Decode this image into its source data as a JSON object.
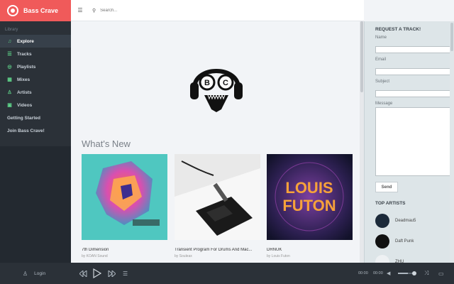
{
  "app": {
    "name": "Bass Crave"
  },
  "sidebar": {
    "section_label": "Library",
    "items": [
      {
        "label": "Explore",
        "icon": "music-note-icon",
        "active": true
      },
      {
        "label": "Tracks",
        "icon": "list-icon"
      },
      {
        "label": "Playlists",
        "icon": "playlist-circle-icon"
      },
      {
        "label": "Mixes",
        "icon": "grid-icon"
      },
      {
        "label": "Artists",
        "icon": "user-icon"
      },
      {
        "label": "Videos",
        "icon": "video-icon"
      }
    ],
    "getting_started": "Getting Started",
    "join": "Join Bass Crave!"
  },
  "topbar": {
    "search_placeholder": "Search..."
  },
  "main": {
    "section_title": "What's New",
    "cards": [
      {
        "title": "7th Dimension",
        "artist": "by KOAN Sound"
      },
      {
        "title": "Transient Program For Drums And Mac...",
        "artist": "by Souleax"
      },
      {
        "title": "DRNUK",
        "artist": "by Louis Futon"
      }
    ],
    "hero_letters": {
      "left": "B",
      "right": "C"
    }
  },
  "right_panel": {
    "request_title": "REQUEST A TRACK!",
    "fields": {
      "name": "Name",
      "email": "Email",
      "subject": "Subject",
      "message": "Message"
    },
    "send_label": "Send",
    "top_artists_title": "TOP ARTISTS",
    "artists": [
      {
        "name": "Deadmau5"
      },
      {
        "name": "Daft Punk"
      },
      {
        "name": "ZHU"
      }
    ]
  },
  "player": {
    "login_label": "Login",
    "current_time": "00:00",
    "duration": "00:00"
  },
  "colors": {
    "brand": "#f05a5a",
    "sidebar_bg": "#2b3138",
    "accent_icon": "#5fd38a",
    "main_bg": "#f2f4f7",
    "right_panel_bg": "#dde5e8"
  }
}
